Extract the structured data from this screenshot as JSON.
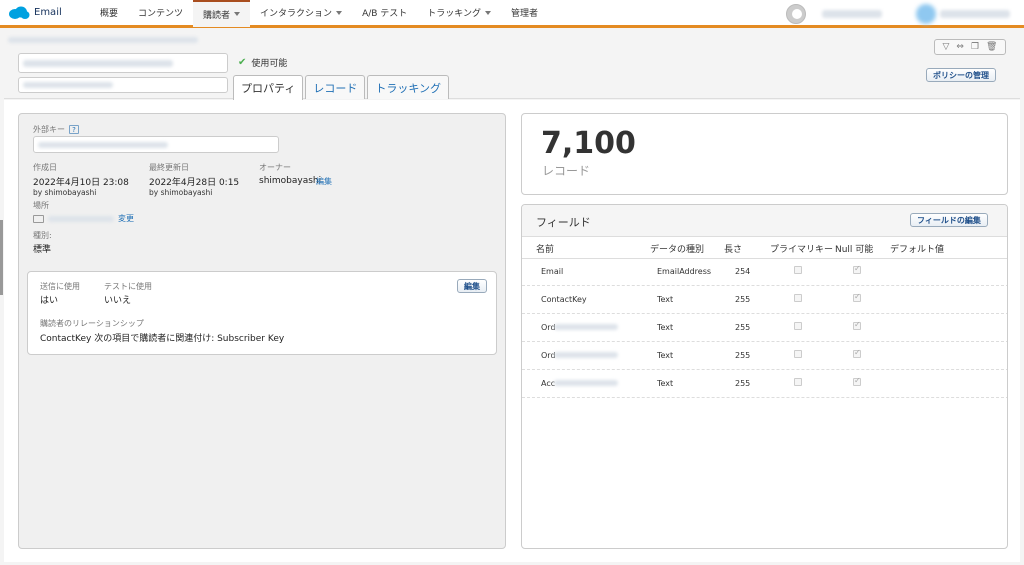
{
  "app": {
    "title": "Email"
  },
  "nav": {
    "items": [
      {
        "label": "概要",
        "caret": false,
        "active": false
      },
      {
        "label": "コンテンツ",
        "caret": false,
        "active": false
      },
      {
        "label": "購読者",
        "caret": true,
        "active": true
      },
      {
        "label": "インタラクション",
        "caret": true,
        "active": false
      },
      {
        "label": "A/B テスト",
        "caret": false,
        "active": false
      },
      {
        "label": "トラッキング",
        "caret": true,
        "active": false
      },
      {
        "label": "管理者",
        "caret": false,
        "active": false
      }
    ]
  },
  "header": {
    "status": "使用可能",
    "tabs": [
      "プロパティ",
      "レコード",
      "トラッキング"
    ],
    "policy_button": "ポリシーの管理"
  },
  "props": {
    "external_key_label": "外部キー",
    "help": "?",
    "created_label": "作成日",
    "created_value": "2022年4月10日 23:08",
    "created_by": "by shimobayashi",
    "modified_label": "最終更新日",
    "modified_value": "2022年4月28日 0:15",
    "modified_by": "by shimobayashi",
    "owner_label": "オーナー",
    "owner_value": "shimobayashi",
    "owner_edit": "編集",
    "location_label": "場所",
    "location_change": "変更",
    "type_label": "種別:",
    "type_value": "標準"
  },
  "sending": {
    "send_label": "送信に使用",
    "send_value": "はい",
    "test_label": "テストに使用",
    "test_value": "いいえ",
    "edit_button": "編集",
    "relationship_label": "購読者のリレーションシップ",
    "relationship_value": "ContactKey 次の項目で購読者に関連付け: Subscriber Key"
  },
  "records": {
    "count": "7,100",
    "label": "レコード"
  },
  "fields": {
    "title": "フィールド",
    "edit_button": "フィールドの編集",
    "columns": [
      "名前",
      "データの種別",
      "長さ",
      "プライマリキー",
      "Null 可能",
      "デフォルト値"
    ],
    "rows": [
      {
        "name": "Email",
        "type": "EmailAddress",
        "length": "254",
        "primary": false,
        "nullable": true
      },
      {
        "name": "ContactKey",
        "type": "Text",
        "length": "255",
        "primary": false,
        "nullable": true
      },
      {
        "name": "Ord",
        "type": "Text",
        "length": "255",
        "primary": false,
        "nullable": true
      },
      {
        "name": "Ord",
        "type": "Text",
        "length": "255",
        "primary": false,
        "nullable": true
      },
      {
        "name": "Acc",
        "type": "Text",
        "length": "255",
        "primary": false,
        "nullable": true
      }
    ]
  },
  "colors": {
    "accent": "#e48b22",
    "link": "#1f6fb5",
    "brand": "#00a1e0"
  }
}
